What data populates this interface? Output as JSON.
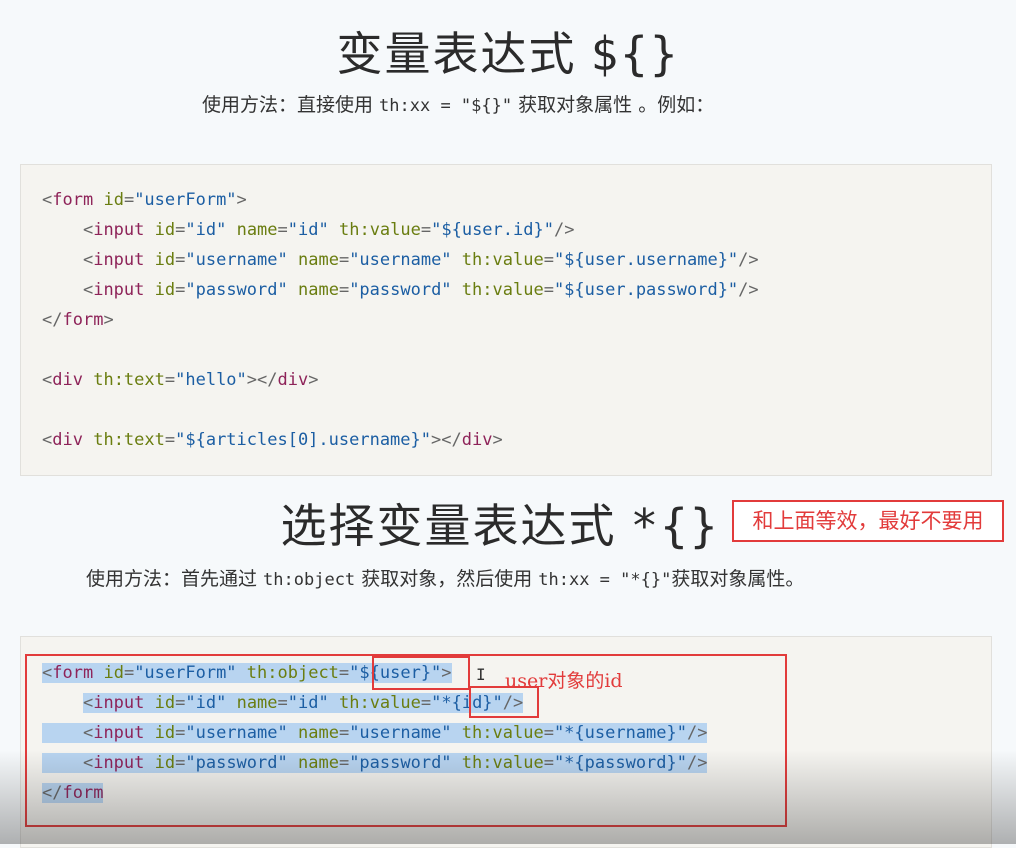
{
  "section1": {
    "title": "变量表达式",
    "symbol": "${}",
    "usage_prefix": "使用方法：直接使用 ",
    "usage_code": "th:xx = \"${}\"",
    "usage_suffix": " 获取对象属性 。例如：",
    "code_lines": [
      [
        "<",
        "form",
        " ",
        "id",
        "=",
        "\"userForm\"",
        ">"
      ],
      [
        "    <input id=\"id\" name=\"id\" th:value=\"${user.id}\"/>"
      ],
      [
        "    <input id=\"username\" name=\"username\" th:value=\"${user.username}\"/>"
      ],
      [
        "    <input id=\"password\" name=\"password\" th:value=\"${user.password}\"/>"
      ],
      [
        "</form>"
      ],
      [
        ""
      ],
      [
        "<div th:text=\"hello\"></div>"
      ],
      [
        ""
      ],
      [
        "<div th:text=\"${articles[0].username}\"></div>"
      ]
    ]
  },
  "section2": {
    "title": "选择变量表达式",
    "symbol": "*{}",
    "note": "和上面等效，最好不要用",
    "usage_prefix": "使用方法：首先通过 ",
    "usage_code1": "th:object",
    "usage_mid": " 获取对象，然后使用 ",
    "usage_code2": "th:xx = \"*{}\"",
    "usage_suffix": "获取对象属性。",
    "annotation": "user对象的id"
  },
  "colors": {
    "tag": "#8e2359",
    "attr": "#6a7d10",
    "string": "#1c5ea3",
    "highlight": "#e23b3b",
    "selection": "#b8d4f0"
  }
}
